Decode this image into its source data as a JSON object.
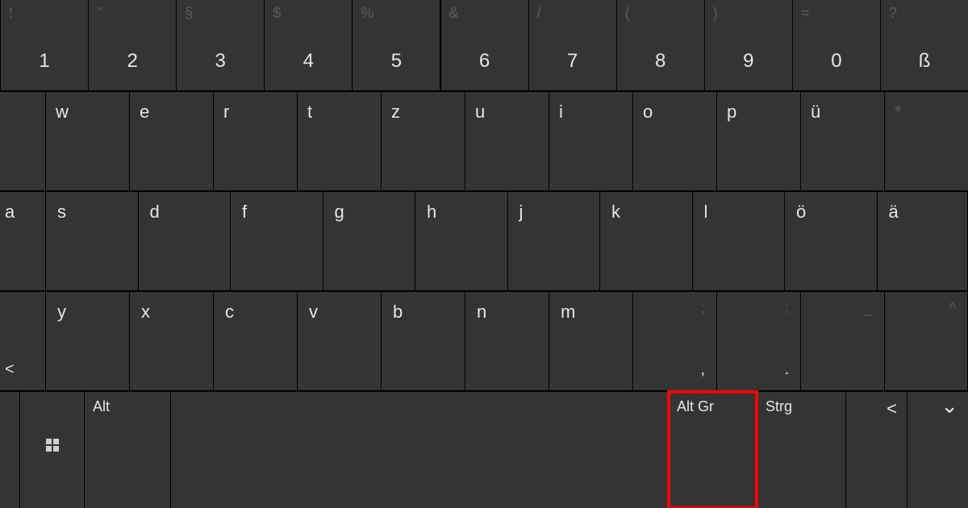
{
  "number_row": {
    "shift": [
      "!",
      "\"",
      "§",
      "$",
      "%",
      "&",
      "/",
      "(",
      ")",
      "=",
      "?"
    ],
    "main": [
      "1",
      "2",
      "3",
      "4",
      "5",
      "6",
      "7",
      "8",
      "9",
      "0",
      "ß"
    ]
  },
  "letter_row1": [
    "w",
    "e",
    "r",
    "t",
    "z",
    "u",
    "i",
    "o",
    "p",
    "ü",
    "*"
  ],
  "letter_row2_first": "a",
  "letter_row2_rest": [
    "s",
    "d",
    "f",
    "g",
    "h",
    "j",
    "k",
    "l",
    "ö",
    "ä"
  ],
  "row3_first_shift": "<",
  "row3_letters": [
    "y",
    "x",
    "c",
    "v",
    "b",
    "n",
    "m"
  ],
  "row3_punct": [
    {
      "shift": ";",
      "main": ","
    },
    {
      "shift": ":",
      "main": "."
    },
    {
      "shift": "_",
      "main": ""
    },
    {
      "shift": "^",
      "main": ""
    }
  ],
  "bottom_row": {
    "alt": "Alt",
    "altgr": "Alt Gr",
    "strg": "Strg",
    "back": "<"
  },
  "chevron_down": "⌄"
}
